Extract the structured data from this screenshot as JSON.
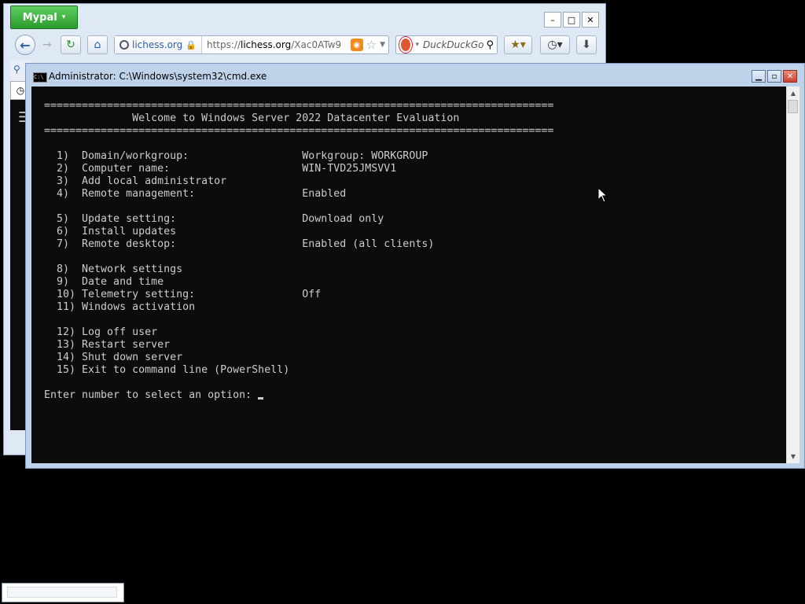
{
  "browser": {
    "app_button_label": "Mypal",
    "app_button_caret": "▾",
    "window_controls": {
      "minimize": "–",
      "maximize": "□",
      "close": "✕"
    },
    "nav": {
      "back": "←",
      "forward": "→",
      "reload": "↻",
      "home": "⌂"
    },
    "identity_label": "lichess.org",
    "url_prefix": "https://",
    "url_host": "lichess.org",
    "url_path": "/Xac0ATw9",
    "search_placeholder": "DuckDuckGo",
    "icons": [
      "back-icon",
      "forward-icon",
      "reload-icon",
      "home-icon",
      "lock-icon",
      "rss-icon",
      "star-icon",
      "search-icon",
      "bookmarks-icon",
      "history-icon",
      "downloads-icon"
    ]
  },
  "cmd": {
    "title": "Administrator: C:\\Windows\\system32\\cmd.exe",
    "window_controls": {
      "minimize": "▁",
      "maximize": "▫",
      "close": "✕"
    },
    "header_rule": "=================================================================================",
    "header_title": "              Welcome to Windows Server 2022 Datacenter Evaluation",
    "menu_groups": [
      [
        "  1)  Domain/workgroup:                  Workgroup: WORKGROUP",
        "  2)  Computer name:                     WIN-TVD25JMSVV1",
        "  3)  Add local administrator",
        "  4)  Remote management:                 Enabled"
      ],
      [
        "  5)  Update setting:                    Download only",
        "  6)  Install updates",
        "  7)  Remote desktop:                    Enabled (all clients)"
      ],
      [
        "  8)  Network settings",
        "  9)  Date and time",
        "  10) Telemetry setting:                 Off",
        "  11) Windows activation"
      ],
      [
        "  12) Log off user",
        "  13) Restart server",
        "  14) Shut down server",
        "  15) Exit to command line (PowerShell)"
      ]
    ],
    "prompt": "Enter number to select an option: ",
    "scroll": {
      "up": "▲",
      "down": "▼"
    }
  }
}
